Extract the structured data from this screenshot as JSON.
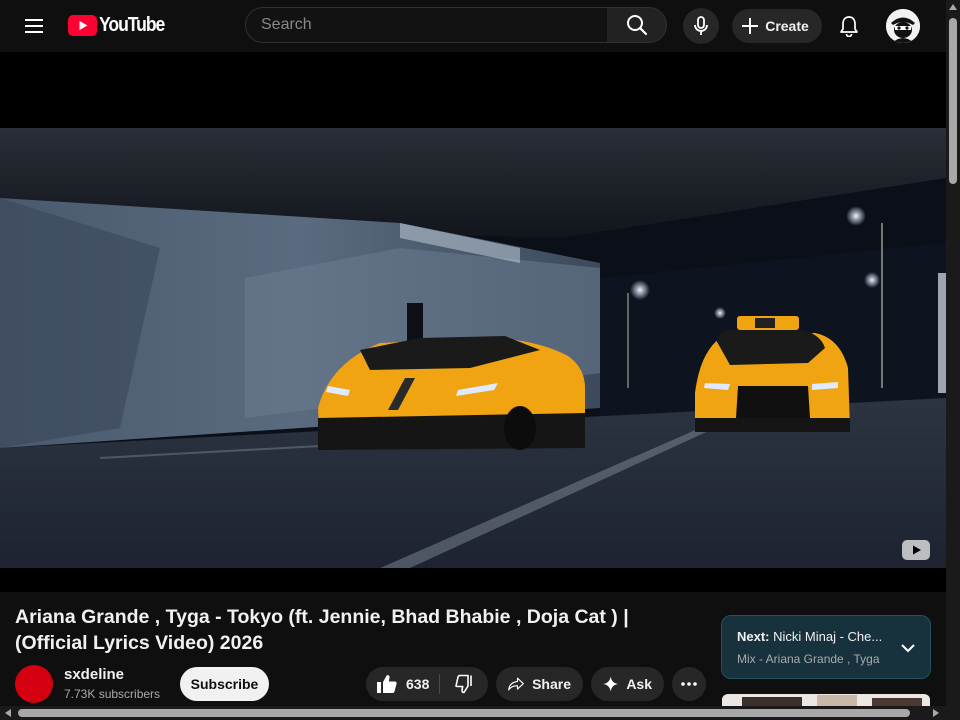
{
  "header": {
    "brand": "YouTube",
    "search_placeholder": "Search",
    "create_label": "Create"
  },
  "video": {
    "title": "Ariana Grande , Tyga - Tokyo (ft. Jennie, Bhad Bhabie , Doja Cat ) | (Official Lyrics Video) 2026"
  },
  "channel": {
    "name": "sxdeline",
    "subscribers": "7.73K subscribers",
    "subscribe_label": "Subscribe"
  },
  "actions": {
    "likes": "638",
    "share_label": "Share",
    "ask_label": "Ask"
  },
  "up_next": {
    "label": "Next:",
    "title": "Nicki Minaj - Che...",
    "subtitle": "Mix - Ariana Grande , Tyga - Tokyo"
  },
  "colors": {
    "background": "#0f0f0f",
    "brand_red": "#ff0033",
    "next_card": "#17323d",
    "channel_avatar": "#d40010"
  }
}
